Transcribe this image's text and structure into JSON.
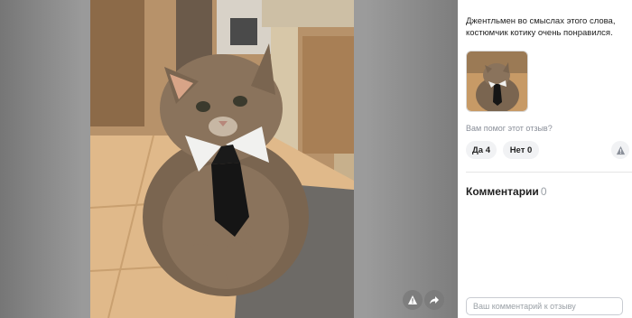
{
  "review": {
    "text": "Джентльмен во смыслах этого слова, костюмчик котику очень понравился."
  },
  "helpful": {
    "question": "Вам помог этот отзыв?",
    "yes_label": "Да 4",
    "no_label": "Нет 0"
  },
  "comments": {
    "title": "Комментарии",
    "count": "0",
    "input_placeholder": "Ваш комментарий к отзыву"
  },
  "viewer": {
    "buttons": [
      "warning-icon",
      "share-icon"
    ]
  }
}
